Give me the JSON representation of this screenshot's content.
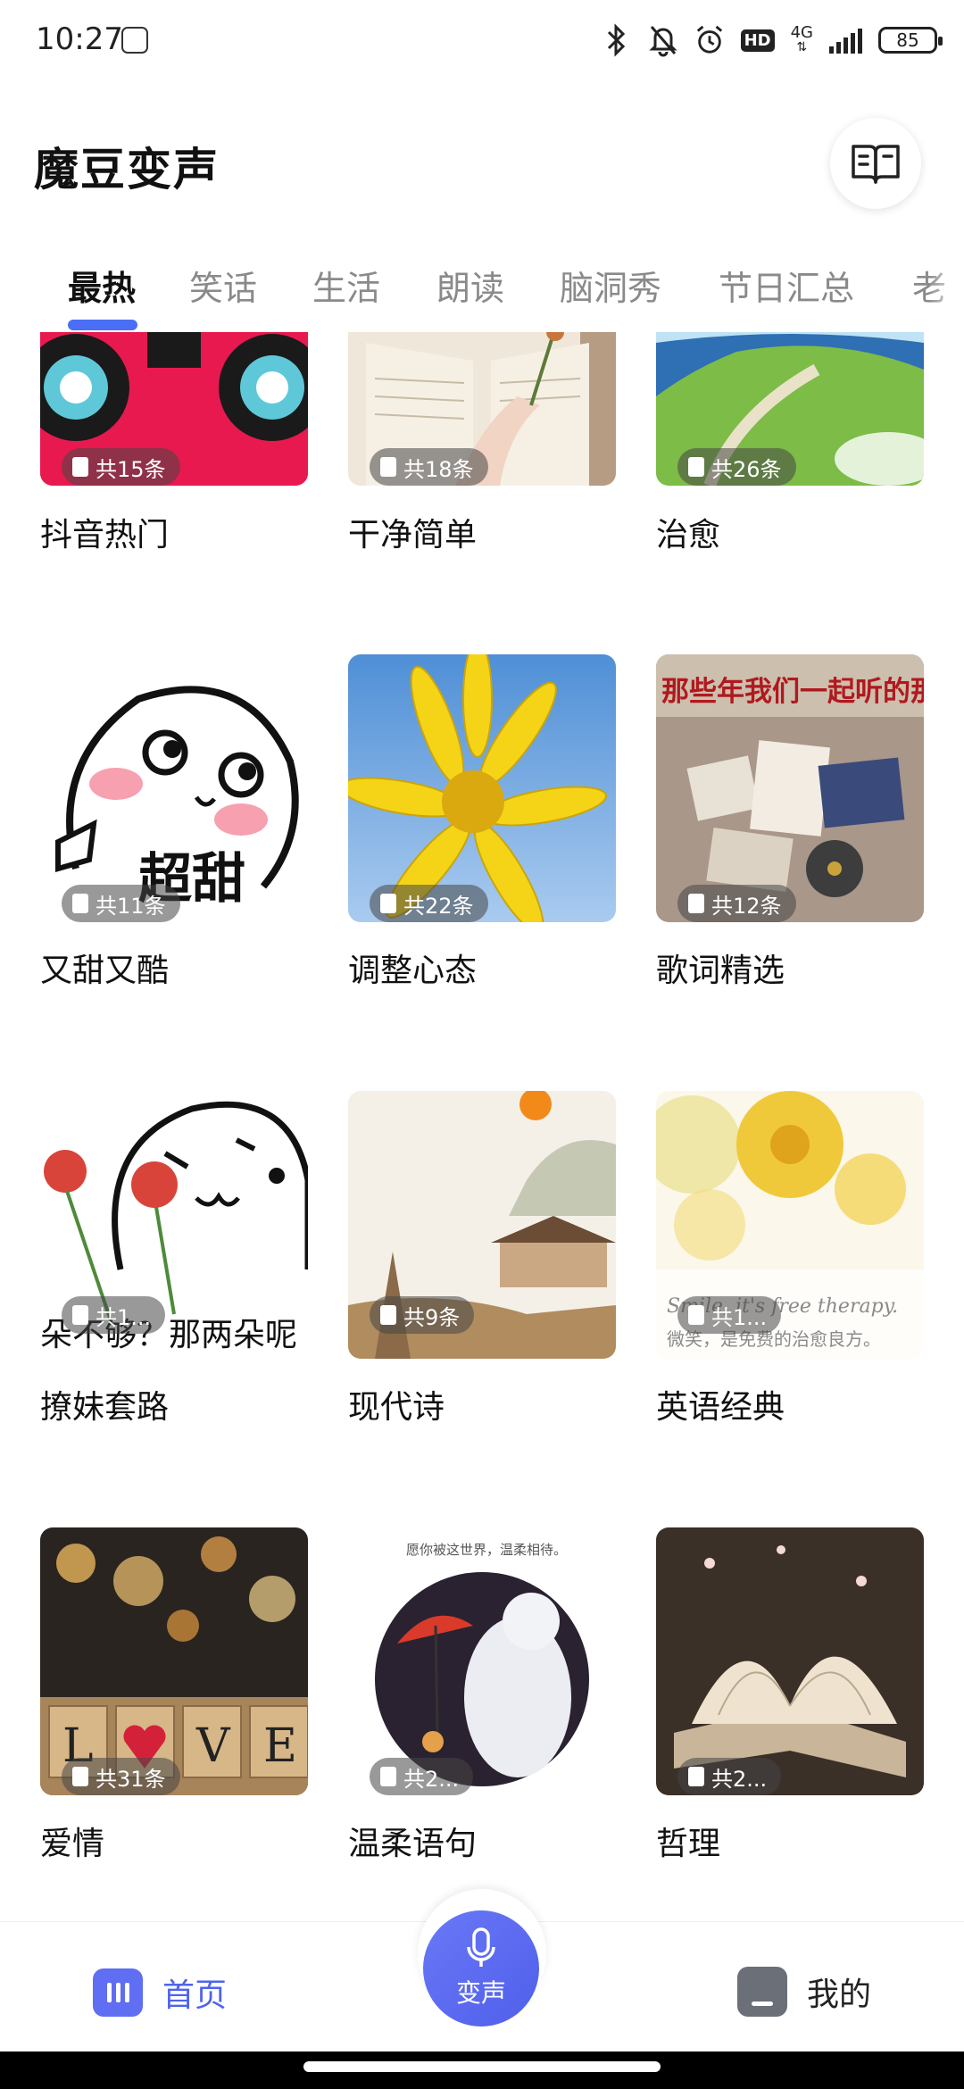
{
  "status_bar": {
    "time": "10:27",
    "network": "4G",
    "hd": "HD",
    "battery": "85"
  },
  "header": {
    "title": "魔豆变声",
    "book_icon": "book-open-icon"
  },
  "tabs": [
    {
      "label": "最热",
      "active": true
    },
    {
      "label": "笑话",
      "active": false
    },
    {
      "label": "生活",
      "active": false
    },
    {
      "label": "朗读",
      "active": false
    },
    {
      "label": "脑洞秀",
      "active": false
    },
    {
      "label": "节日汇总",
      "active": false
    },
    {
      "label": "老",
      "active": false
    }
  ],
  "cards": [
    {
      "title": "抖音热门",
      "count": "共15条",
      "colors": [
        "#e8194f",
        "#1b1b1b"
      ]
    },
    {
      "title": "干净简单",
      "count": "共18条",
      "colors": [
        "#efe6d9",
        "#b8a48c"
      ]
    },
    {
      "title": "治愈",
      "count": "共26条",
      "colors": [
        "#2c6fb8",
        "#7fbf4a"
      ]
    },
    {
      "title": "又甜又酷",
      "count": "共11条",
      "colors": [
        "#ffffff",
        "#f7a8b8"
      ]
    },
    {
      "title": "调整心态",
      "count": "共22条",
      "colors": [
        "#6fa3dc",
        "#f5d21a"
      ]
    },
    {
      "title": "歌词精选",
      "count": "共12条",
      "colors": [
        "#8a7a6e",
        "#c9b8a5"
      ]
    },
    {
      "title": "撩妹套路",
      "count": "共1...",
      "colors": [
        "#ffffff",
        "#d9443a"
      ]
    },
    {
      "title": "现代诗",
      "count": "共9条",
      "colors": [
        "#f3efe6",
        "#b8a07a"
      ]
    },
    {
      "title": "英语经典",
      "count": "共1...",
      "colors": [
        "#fbf4d8",
        "#f1c53a"
      ]
    },
    {
      "title": "爱情",
      "count": "共31条",
      "colors": [
        "#2a2420",
        "#c98a3a"
      ]
    },
    {
      "title": "温柔语句",
      "count": "共2...",
      "colors": [
        "#2a2230",
        "#e9e9ef"
      ]
    },
    {
      "title": "哲理",
      "count": "共2...",
      "colors": [
        "#3a3028",
        "#efe3cf"
      ]
    }
  ],
  "card_images_text": {
    "sweet_caption": "超甜",
    "flirt_caption": "朵不够？那两朵呢",
    "english_quote": "Smile, it's free therapy.",
    "english_quote_cn": "微笑，是免费的治愈良方。",
    "gentle_caption": "愿你被这世界，温柔相待。",
    "lyrics_caption": "那些年我们一起听的那些",
    "love_letters": [
      "L",
      "V",
      "E"
    ]
  },
  "bottom_nav": {
    "home_label": "首页",
    "voice_label": "变声",
    "mine_label": "我的"
  },
  "accent_color": "#4e63ee"
}
